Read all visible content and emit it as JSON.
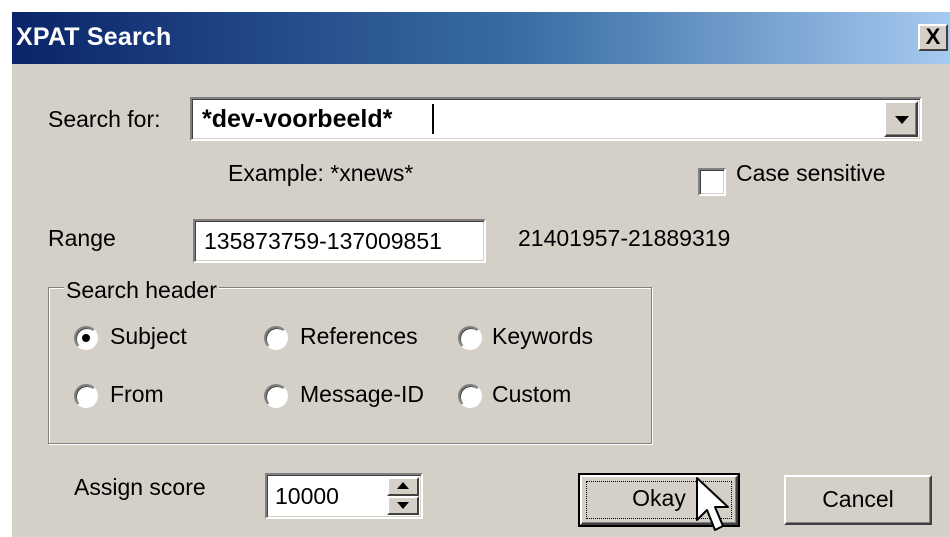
{
  "window": {
    "title": "XPAT Search",
    "close_label": "X"
  },
  "search": {
    "label": "Search for:",
    "value": "*dev-voorbeeld*",
    "example": "Example: *xnews*",
    "case_sensitive_label": "Case sensitive",
    "case_sensitive_checked": false
  },
  "range": {
    "label": "Range",
    "value": "135873759-137009851",
    "available": "21401957-21889319"
  },
  "search_header": {
    "legend": "Search header",
    "options": [
      {
        "label": "Subject",
        "selected": true
      },
      {
        "label": "References",
        "selected": false
      },
      {
        "label": "Keywords",
        "selected": false
      },
      {
        "label": "From",
        "selected": false
      },
      {
        "label": "Message-ID",
        "selected": false
      },
      {
        "label": "Custom",
        "selected": false
      }
    ]
  },
  "score": {
    "label": "Assign score",
    "value": "10000"
  },
  "buttons": {
    "okay": "Okay",
    "cancel": "Cancel"
  },
  "icons": {
    "combo_arrow": "chevron-down-icon",
    "spin_up": "spin-up-icon",
    "spin_down": "spin-down-icon",
    "cursor": "mouse-pointer-icon"
  }
}
